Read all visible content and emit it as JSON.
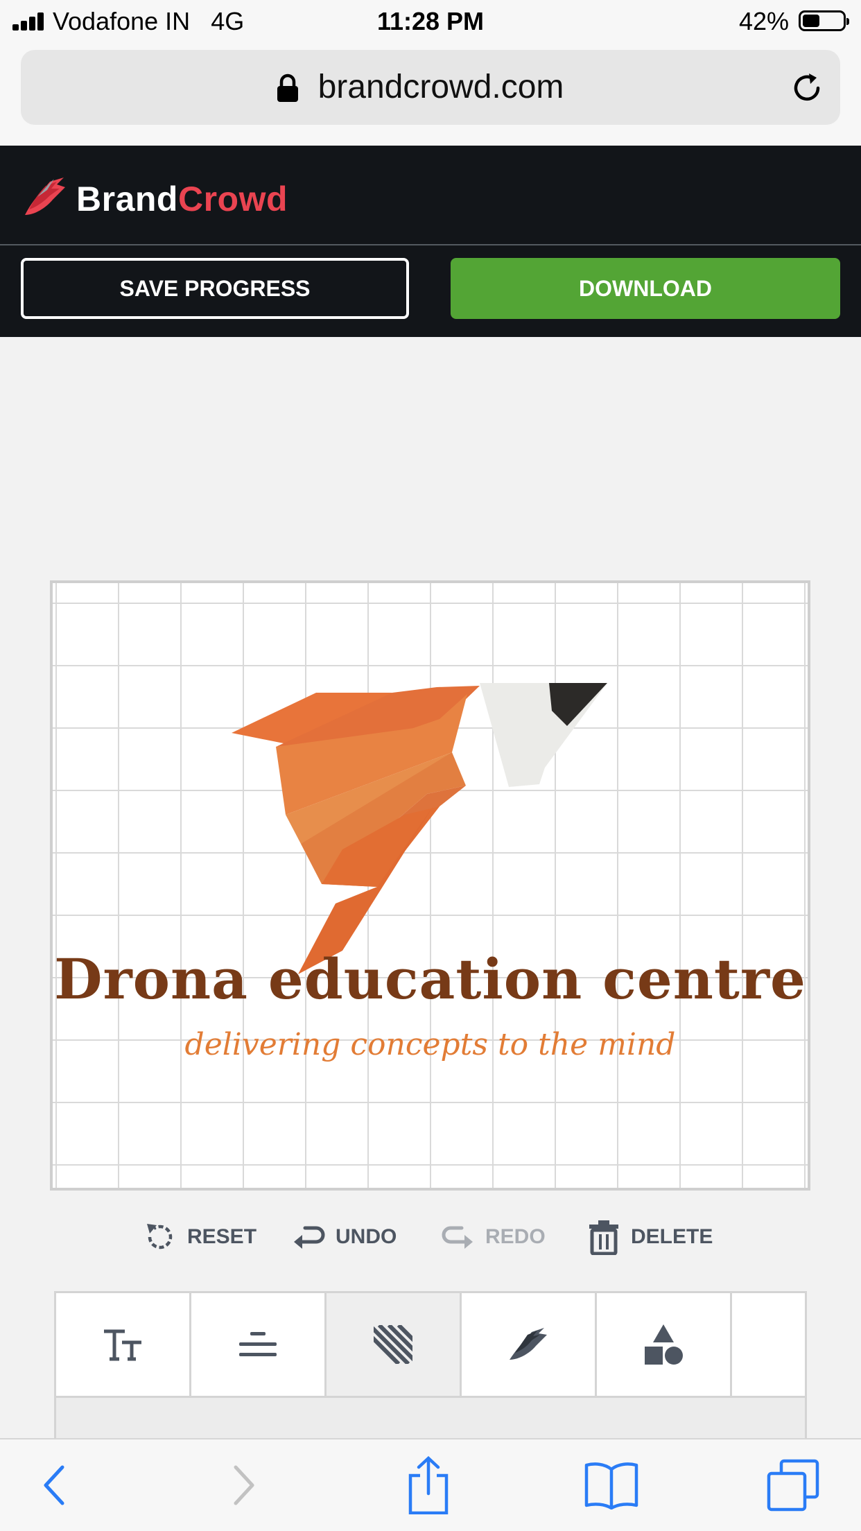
{
  "status_bar": {
    "carrier": "Vodafone IN",
    "network": "4G",
    "time": "11:28 PM",
    "battery": "42%",
    "battery_level": 0.42
  },
  "browser": {
    "url": "brandcrowd.com"
  },
  "header": {
    "brand_first": "Brand",
    "brand_second": "Crowd",
    "brand_second_color": "#ea4451"
  },
  "actions": {
    "save_label": "SAVE PROGRESS",
    "download_label": "DOWNLOAD",
    "download_color": "#53a535"
  },
  "canvas": {
    "logo_name": "Drona education centre",
    "logo_tagline": "delivering concepts to the mind",
    "name_color": "#773a17",
    "tagline_color": "#e27c35"
  },
  "edit_tools": {
    "reset": "RESET",
    "undo": "UNDO",
    "redo": "REDO",
    "delete": "DELETE"
  },
  "editor_tabs": [
    {
      "icon": "text-size-icon",
      "active": false
    },
    {
      "icon": "align-icon",
      "active": false
    },
    {
      "icon": "pattern-icon",
      "active": true
    },
    {
      "icon": "symbol-icon",
      "active": false
    },
    {
      "icon": "shapes-icon",
      "active": false
    }
  ],
  "safari_toolbar": {
    "icons": [
      "back-icon",
      "forward-icon",
      "share-icon",
      "bookmarks-icon",
      "tabs-icon"
    ]
  }
}
